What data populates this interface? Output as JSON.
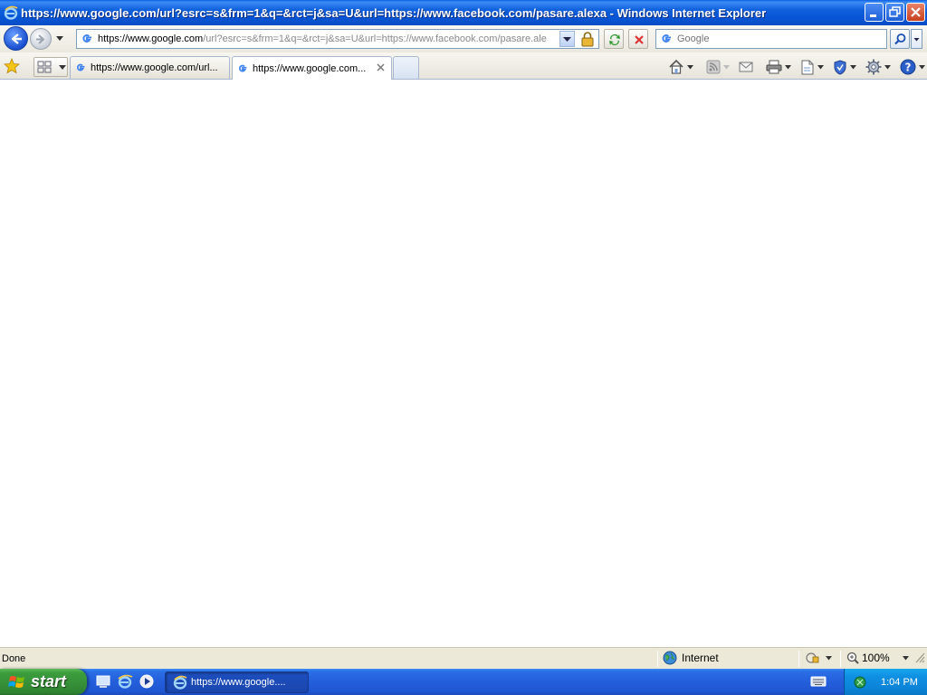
{
  "window": {
    "title": "https://www.google.com/url?esrc=s&frm=1&q=&rct=j&sa=U&url=https://www.facebook.com/pasare.alexa - Windows Internet Explorer"
  },
  "address_bar": {
    "url_prefix": "https://",
    "url_domain": "www.google.com",
    "url_rest": "/url?esrc=s&frm=1&q=&rct=j&sa=U&url=https://www.facebook.com/pasare.ale"
  },
  "search": {
    "placeholder": "Google"
  },
  "tabs": [
    {
      "label": "https://www.google.com/url...",
      "active": false
    },
    {
      "label": "https://www.google.com...",
      "active": true
    }
  ],
  "status_bar": {
    "status": "Done",
    "zone": "Internet",
    "zoom": "100%"
  },
  "taskbar": {
    "start_label": "start",
    "task_label": "https://www.google....",
    "clock": "1:04 PM"
  },
  "colors": {
    "titlebar": "#0755d6",
    "taskbar": "#245edb",
    "start": "#37923a",
    "tray": "#0b85d9"
  }
}
